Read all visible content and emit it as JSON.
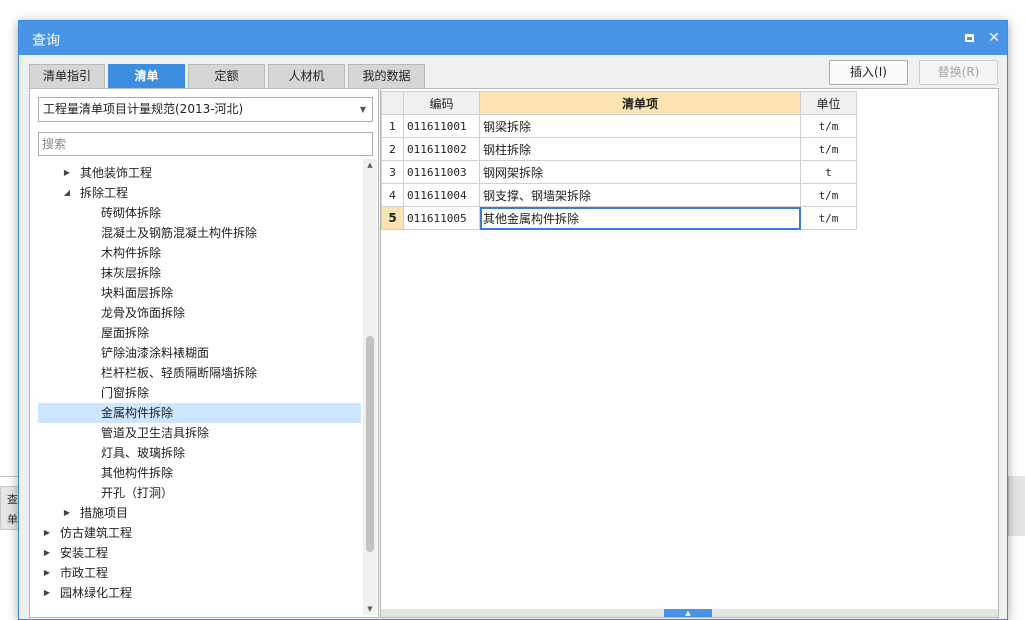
{
  "window": {
    "title": "查询"
  },
  "background": {
    "cell_label_top": "查",
    "cell_label_bottom": "单"
  },
  "tabs": [
    {
      "label": "清单指引",
      "active": false
    },
    {
      "label": "清单",
      "active": true
    },
    {
      "label": "定额",
      "active": false
    },
    {
      "label": "人材机",
      "active": false
    },
    {
      "label": "我的数据",
      "active": false
    }
  ],
  "toolbar": {
    "insert_label": "插入(I)",
    "replace_label": "替换(R)"
  },
  "left": {
    "spec_select_value": "工程量清单项目计量规范(2013-河北)",
    "search_placeholder": "搜索",
    "tree": [
      {
        "label": "其他装饰工程",
        "level": 1,
        "toggle": "collapsed"
      },
      {
        "label": "拆除工程",
        "level": 1,
        "toggle": "expanded"
      },
      {
        "label": "砖砌体拆除",
        "level": 2
      },
      {
        "label": "混凝土及钢筋混凝土构件拆除",
        "level": 2
      },
      {
        "label": "木构件拆除",
        "level": 2
      },
      {
        "label": "抹灰层拆除",
        "level": 2
      },
      {
        "label": "块料面层拆除",
        "level": 2
      },
      {
        "label": "龙骨及饰面拆除",
        "level": 2
      },
      {
        "label": "屋面拆除",
        "level": 2
      },
      {
        "label": "铲除油漆涂料裱糊面",
        "level": 2
      },
      {
        "label": "栏杆栏板、轻质隔断隔墙拆除",
        "level": 2
      },
      {
        "label": "门窗拆除",
        "level": 2
      },
      {
        "label": "金属构件拆除",
        "level": 2,
        "selected": true
      },
      {
        "label": "管道及卫生洁具拆除",
        "level": 2
      },
      {
        "label": "灯具、玻璃拆除",
        "level": 2
      },
      {
        "label": "其他构件拆除",
        "level": 2
      },
      {
        "label": "开孔（打洞）",
        "level": 2
      },
      {
        "label": "措施项目",
        "level": 1,
        "toggle": "collapsed"
      },
      {
        "label": "仿古建筑工程",
        "level": 0,
        "toggle": "collapsed"
      },
      {
        "label": "安装工程",
        "level": 0,
        "toggle": "collapsed"
      },
      {
        "label": "市政工程",
        "level": 0,
        "toggle": "collapsed"
      },
      {
        "label": "园林绿化工程",
        "level": 0,
        "toggle": "collapsed"
      }
    ]
  },
  "grid": {
    "headers": {
      "code": "编码",
      "name": "清单项",
      "unit": "单位"
    },
    "rows": [
      {
        "num": "1",
        "code": "011611001",
        "name": "钢梁拆除",
        "unit": "t/m"
      },
      {
        "num": "2",
        "code": "011611002",
        "name": "钢柱拆除",
        "unit": "t/m"
      },
      {
        "num": "3",
        "code": "011611003",
        "name": "钢网架拆除",
        "unit": "t"
      },
      {
        "num": "4",
        "code": "011611004",
        "name": "钢支撑、钢墙架拆除",
        "unit": "t/m"
      },
      {
        "num": "5",
        "code": "011611005",
        "name": "其他金属构件拆除",
        "unit": "t/m",
        "current": true
      }
    ]
  },
  "icons": {
    "maximize": "maximize-icon",
    "close": "close-icon",
    "dropdown": "chevron-down-icon",
    "expanded": "triangle-down-icon",
    "collapsed": "triangle-right-icon"
  }
}
